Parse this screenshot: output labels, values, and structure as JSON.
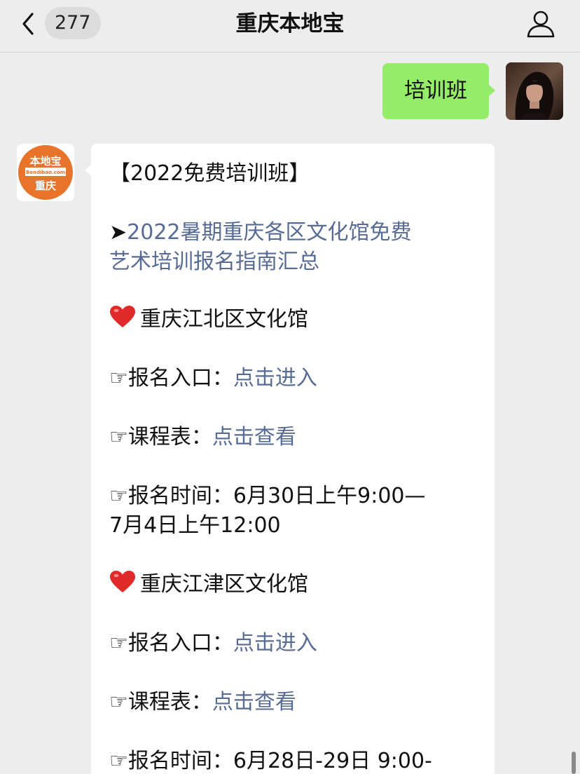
{
  "header": {
    "unread_count": "277",
    "title": "重庆本地宝"
  },
  "outgoing_message": {
    "text": "培训班"
  },
  "bot_avatar": {
    "logo_top": "本地宝",
    "logo_url": "Bendibao.com",
    "logo_city": "重庆"
  },
  "incoming_message": {
    "heading": "【2022免费培训班】",
    "arrow_glyph": "➤",
    "guide_link_line1": "2022暑期重庆各区文化馆免费",
    "guide_link_line2": "艺术培训报名指南汇总",
    "sections": [
      {
        "name": "重庆江北区文化馆",
        "signup_label": "☞报名入口：",
        "signup_link": "点击进入",
        "schedule_label": "☞课程表：",
        "schedule_link": "点击查看",
        "time_line1": "☞报名时间：6月30日上午9:00—",
        "time_line2": "7月4日上午12:00"
      },
      {
        "name": "重庆江津区文化馆",
        "signup_label": "☞报名入口：",
        "signup_link": "点击进入",
        "schedule_label": "☞课程表：",
        "schedule_link": "点击查看",
        "time_line1": "☞报名时间：6月28日-29日 9:00-"
      }
    ]
  },
  "colors": {
    "background": "#ededed",
    "outgoing_bubble": "#95ec69",
    "incoming_bubble": "#ffffff",
    "link": "#576b95",
    "logo_orange": "#e8732a",
    "heart": "#e02a2a"
  }
}
